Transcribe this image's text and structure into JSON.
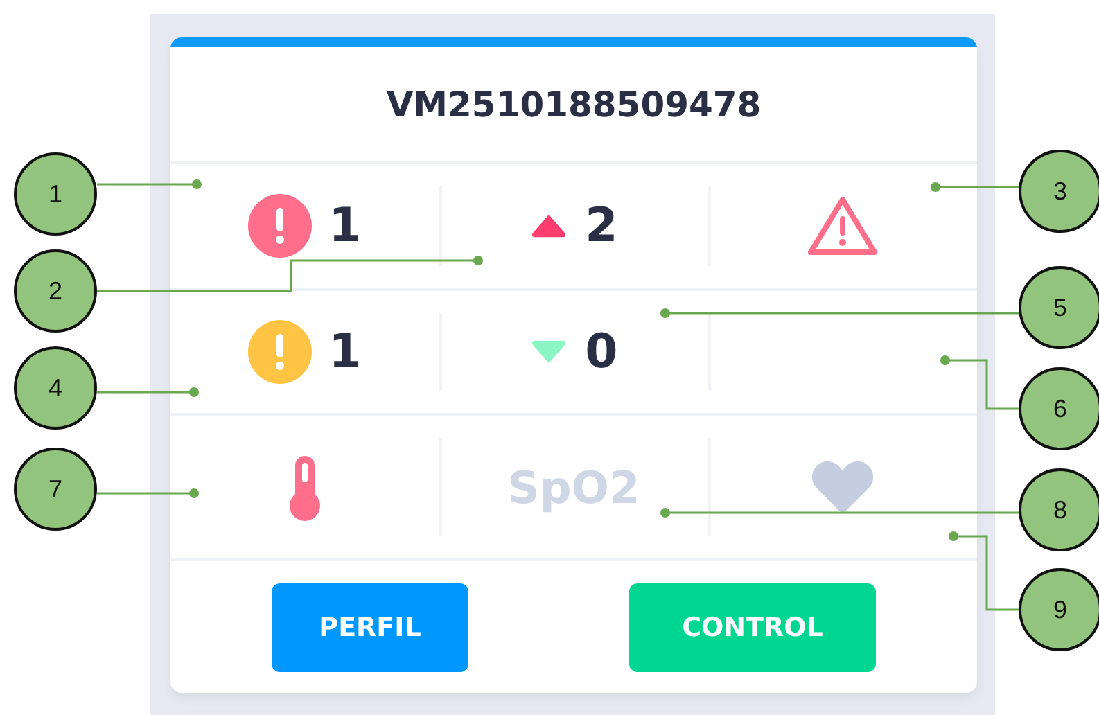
{
  "card": {
    "title": "VM2510188509478",
    "rows": [
      [
        {
          "kind": "critical",
          "value": "1"
        },
        {
          "kind": "up",
          "value": "2"
        },
        {
          "kind": "warning"
        }
      ],
      [
        {
          "kind": "caution",
          "value": "1"
        },
        {
          "kind": "down",
          "value": "0"
        },
        {
          "kind": "empty"
        }
      ],
      [
        {
          "kind": "thermometer"
        },
        {
          "kind": "label",
          "value": "SpO2"
        },
        {
          "kind": "heart"
        }
      ]
    ],
    "buttons": [
      {
        "label": "PERFIL",
        "kind": "profile"
      },
      {
        "label": "CONTROL",
        "kind": "control"
      }
    ]
  },
  "left_callouts": [
    "1",
    "2",
    "4",
    "7"
  ],
  "right_callouts": [
    "3",
    "5",
    "6",
    "8",
    "9"
  ]
}
